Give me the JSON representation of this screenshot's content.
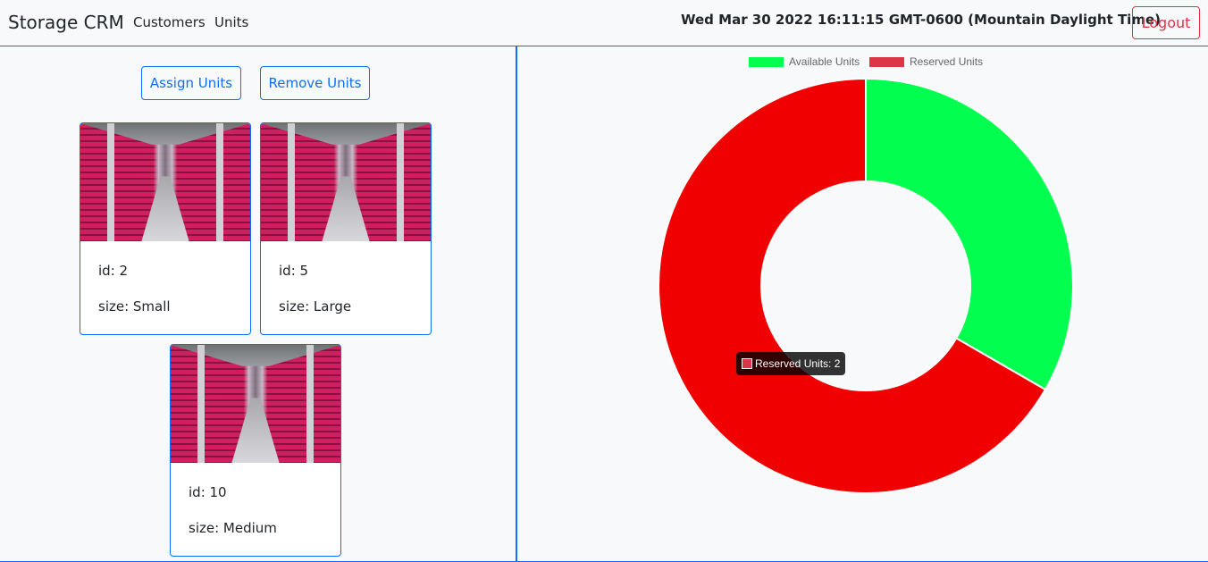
{
  "navbar": {
    "brand": "Storage CRM",
    "links": [
      "Customers",
      "Units"
    ],
    "datetime": "Wed Mar 30 2022 16:11:15 GMT-0600 (Mountain Daylight Time)",
    "logout_label": "Logout"
  },
  "actions": {
    "assign_label": "Assign Units",
    "remove_label": "Remove Units"
  },
  "units": [
    {
      "id_text": "id: 2",
      "size_text": "size: Small"
    },
    {
      "id_text": "id: 5",
      "size_text": "size: Large"
    },
    {
      "id_text": "id: 10",
      "size_text": "size: Medium"
    }
  ],
  "chart_data": {
    "type": "pie",
    "categories": [
      "Available Units",
      "Reserved Units"
    ],
    "values": [
      1,
      2
    ],
    "colors": [
      "#00ff4f",
      "#f00000"
    ],
    "legend_colors": [
      "#00ff4f",
      "#dc3545"
    ],
    "legend": "top",
    "tooltip": "Reserved Units: 2"
  }
}
